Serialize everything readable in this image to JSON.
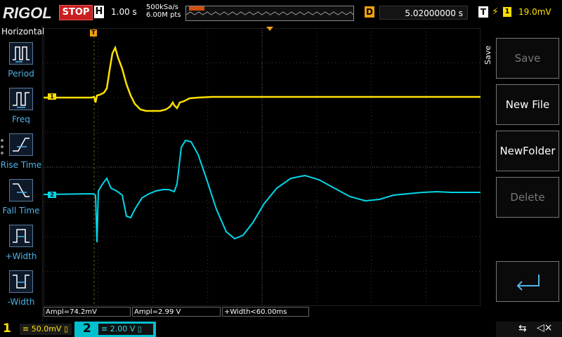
{
  "brand": "RIGOL",
  "status": "STOP",
  "horizontal": {
    "badge": "H",
    "timebase": "1.00 s",
    "sample_rate": "500kSa/s",
    "memory_depth": "6.00M pts"
  },
  "delay": {
    "badge": "D",
    "value": "5.02000000 s"
  },
  "trigger": {
    "badge": "T",
    "edge": "rising-edge-icon",
    "source": "1",
    "level": "19.0mV"
  },
  "left_menu": {
    "title": "Horizontal",
    "items": [
      {
        "label": "Period",
        "icon": "period-icon"
      },
      {
        "label": "Freq",
        "icon": "freq-icon"
      },
      {
        "label": "Rise Time",
        "icon": "rise-time-icon"
      },
      {
        "label": "Fall Time",
        "icon": "fall-time-icon"
      },
      {
        "label": "+Width",
        "icon": "positive-width-icon"
      },
      {
        "label": "-Width",
        "icon": "negative-width-icon"
      }
    ]
  },
  "right_menu": {
    "tab": "Save",
    "buttons": [
      {
        "label": "Save",
        "enabled": false
      },
      {
        "label": "New File",
        "enabled": true
      },
      {
        "label": "NewFolder",
        "enabled": true
      },
      {
        "label": "Delete",
        "enabled": false
      },
      {
        "label": "",
        "icon": "enter-icon",
        "enabled": true
      }
    ]
  },
  "measurements": [
    "Ampl=74.2mV",
    "Ampl=2.99 V",
    "+Width<60.00ms"
  ],
  "channels": [
    {
      "num": "1",
      "scale": "50.0mV",
      "color": "#ffe000",
      "marker": "1"
    },
    {
      "num": "2",
      "scale": "2.00 V",
      "color": "#00d8e8",
      "marker": "2"
    }
  ],
  "colors": {
    "ch1": "#ffe000",
    "ch2": "#00d8e8",
    "trigger": "#f0a010",
    "stop": "#c82020",
    "menu_label": "#4fb3e6"
  },
  "status_icons": [
    "usb-icon",
    "speaker-muted-icon"
  ]
}
